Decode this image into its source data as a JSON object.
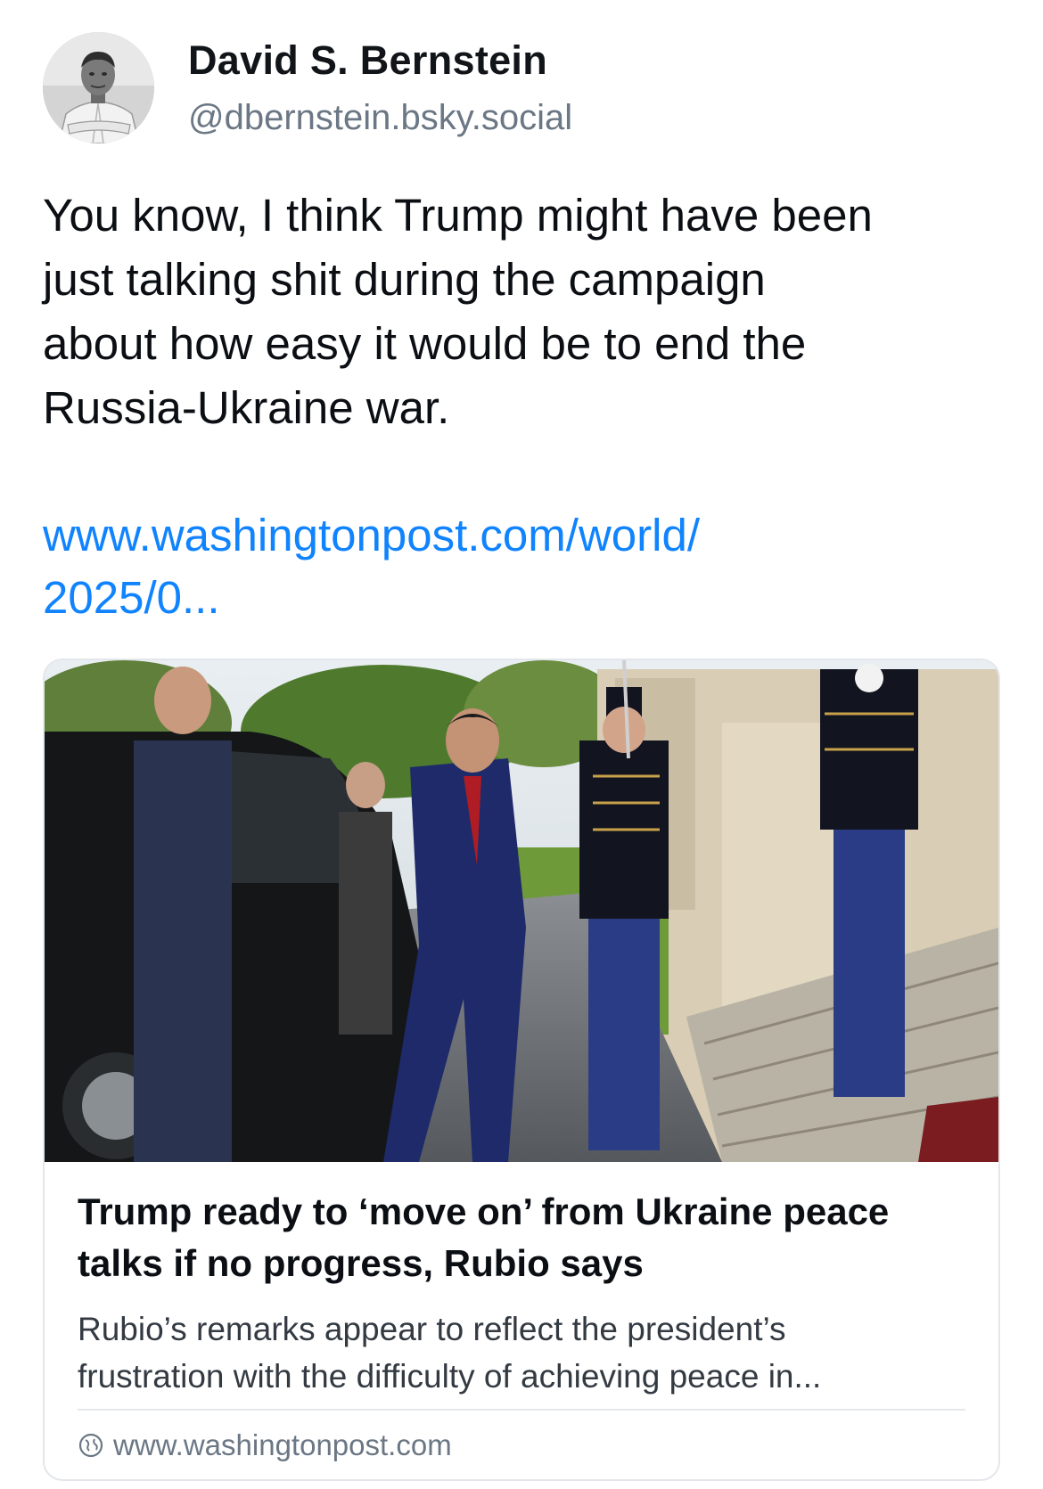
{
  "author": {
    "display_name": "David S. Bernstein",
    "handle": "@dbernstein.bsky.social",
    "avatar_icon": "person-avatar"
  },
  "post": {
    "text_lines": [
      "You know, I think Trump might have been",
      "just talking shit during the campaign",
      "about how easy it would be to end the",
      "Russia-Ukraine war."
    ],
    "link_lines": [
      "www.washingtonpost.com/world/",
      "2025/0..."
    ]
  },
  "link_card": {
    "image_icon": "news-photo",
    "title_lines": [
      "Trump ready to ‘move on’ from Ukraine peace",
      "talks if no progress, Rubio says"
    ],
    "description_lines": [
      "Rubio’s remarks appear to reflect the president’s",
      "frustration with the difficulty of achieving peace in..."
    ],
    "domain_icon": "globe-icon",
    "domain": "www.washingtonpost.com"
  },
  "colors": {
    "link": "#1083fe",
    "text": "#0b0f14",
    "muted": "#6b7785",
    "border": "#e3e6ea"
  }
}
